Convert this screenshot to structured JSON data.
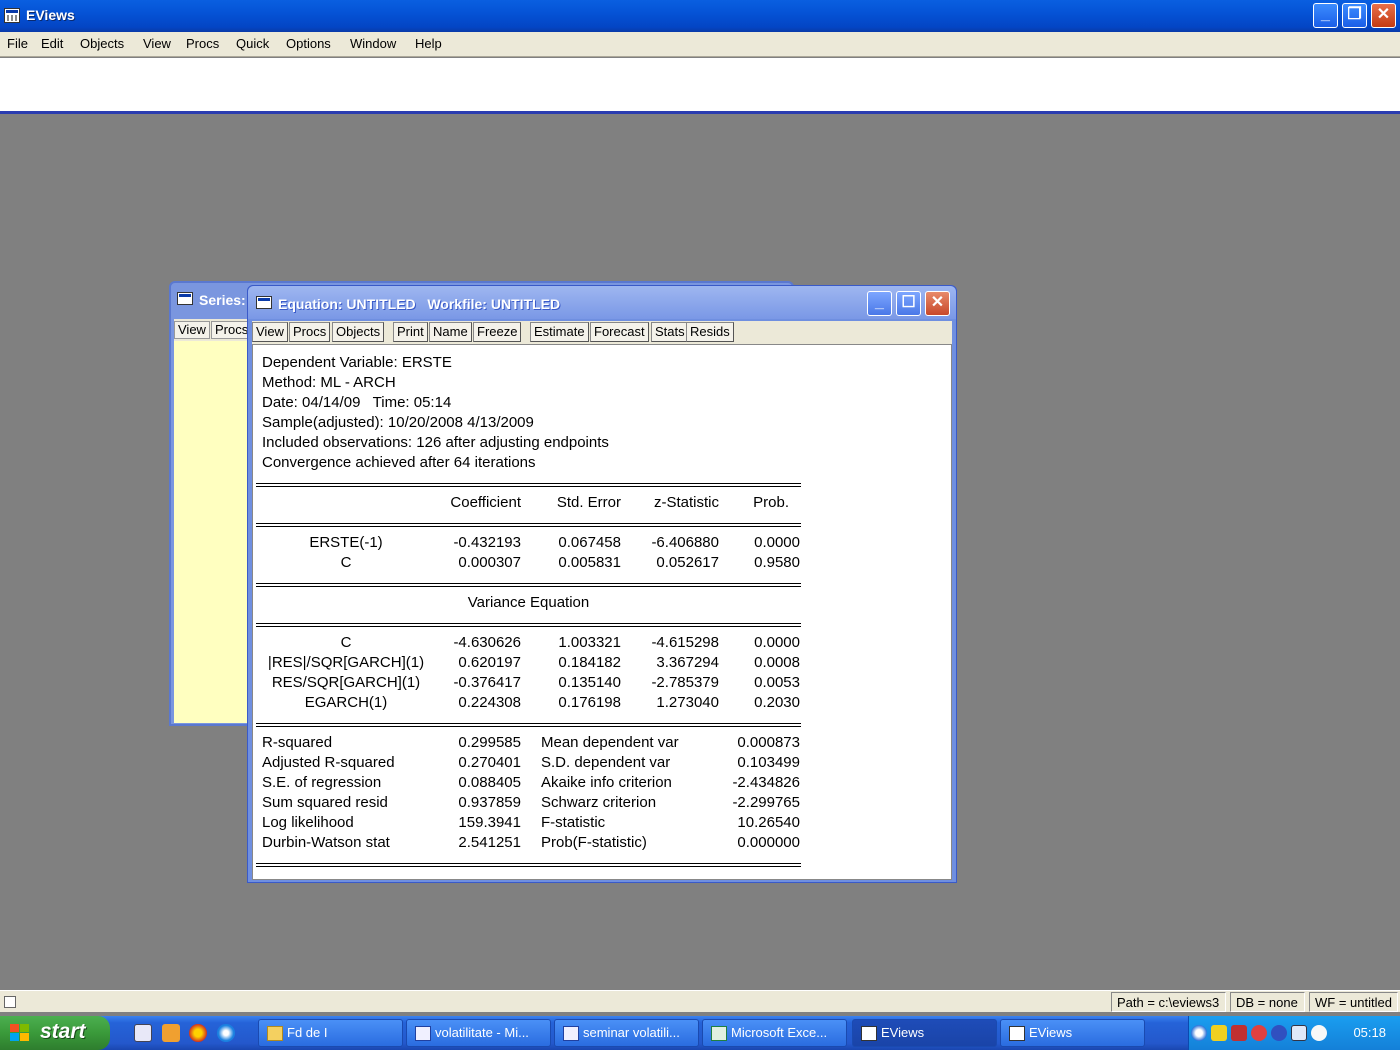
{
  "app": {
    "title": "EViews",
    "menu": [
      "File",
      "Edit",
      "Objects",
      "View",
      "Procs",
      "Quick",
      "Options",
      "Window",
      "Help"
    ]
  },
  "series_window": {
    "title": "Series:",
    "toolbar": [
      "View",
      "Procs"
    ]
  },
  "equation_window": {
    "title": "Equation: UNTITLED   Workfile: UNTITLED",
    "toolbar": [
      "View",
      "Procs",
      "Objects",
      "Print",
      "Name",
      "Freeze",
      "Estimate",
      "Forecast",
      "Stats",
      "Resids"
    ],
    "header": [
      "Dependent Variable: ERSTE",
      "Method: ML - ARCH",
      "Date: 04/14/09   Time: 05:14",
      "Sample(adjusted): 10/20/2008 4/13/2009",
      "Included observations: 126 after adjusting endpoints",
      "Convergence achieved after 64 iterations"
    ],
    "columns": [
      "Coefficient",
      "Std. Error",
      "z-Statistic",
      "Prob."
    ],
    "mean_rows": [
      {
        "var": "ERSTE(-1)",
        "coef": "-0.432193",
        "se": "0.067458",
        "z": "-6.406880",
        "p": "0.0000"
      },
      {
        "var": "C",
        "coef": "0.000307",
        "se": "0.005831",
        "z": "0.052617",
        "p": "0.9580"
      }
    ],
    "variance_title": "Variance Equation",
    "variance_rows": [
      {
        "var": "C",
        "coef": "-4.630626",
        "se": "1.003321",
        "z": "-4.615298",
        "p": "0.0000"
      },
      {
        "var": "|RES|/SQR[GARCH](1)",
        "coef": "0.620197",
        "se": "0.184182",
        "z": "3.367294",
        "p": "0.0008"
      },
      {
        "var": "RES/SQR[GARCH](1)",
        "coef": "-0.376417",
        "se": "0.135140",
        "z": "-2.785379",
        "p": "0.0053"
      },
      {
        "var": "EGARCH(1)",
        "coef": "0.224308",
        "se": "0.176198",
        "z": "1.273040",
        "p": "0.2030"
      }
    ],
    "stats_rows": [
      {
        "l1": "R-squared",
        "v1": "0.299585",
        "l2": "Mean dependent var",
        "v2": "0.000873"
      },
      {
        "l1": "Adjusted R-squared",
        "v1": "0.270401",
        "l2": "S.D. dependent var",
        "v2": "0.103499"
      },
      {
        "l1": "S.E. of regression",
        "v1": "0.088405",
        "l2": "Akaike info criterion",
        "v2": "-2.434826"
      },
      {
        "l1": "Sum squared resid",
        "v1": "0.937859",
        "l2": "Schwarz criterion",
        "v2": "-2.299765"
      },
      {
        "l1": "Log likelihood",
        "v1": "159.3941",
        "l2": "F-statistic",
        "v2": "10.26540"
      },
      {
        "l1": "Durbin-Watson stat",
        "v1": "2.541251",
        "l2": "Prob(F-statistic)",
        "v2": "0.000000"
      }
    ]
  },
  "statusbar": {
    "path": "Path = c:\\eviews3",
    "db": "DB = none",
    "wf": "WF = untitled"
  },
  "taskbar": {
    "start_label": "start",
    "tasks": [
      {
        "label": "Fd de I",
        "icon": "folder-icon"
      },
      {
        "label": "volatilitate - Mi...",
        "icon": "word-icon"
      },
      {
        "label": "seminar volatili...",
        "icon": "word-icon"
      },
      {
        "label": "Microsoft Exce...",
        "icon": "excel-icon"
      },
      {
        "label": "EViews",
        "icon": "eviews-icon"
      },
      {
        "label": "EViews",
        "icon": "eviews-icon"
      }
    ],
    "clock": "05:18"
  }
}
